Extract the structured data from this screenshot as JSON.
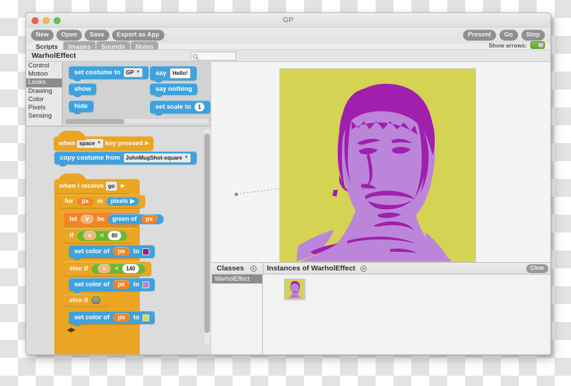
{
  "window": {
    "title": "GP",
    "traffic_lights": [
      "close-red",
      "minimize-yellow",
      "maximize-green"
    ]
  },
  "toolbar": {
    "buttons": [
      "New",
      "Open",
      "Save",
      "Export as App"
    ],
    "right_buttons": [
      "Present",
      "Go",
      "Stop"
    ],
    "show_arrows_label": "Show arrows:",
    "show_arrows_on": true,
    "toggle_color": "#5fa930"
  },
  "tabs": [
    {
      "label": "Scripts",
      "active": true
    },
    {
      "label": "Images",
      "active": false
    },
    {
      "label": "Sounds",
      "active": false
    },
    {
      "label": "Notes",
      "active": false
    }
  ],
  "class_header": {
    "name": "WarholEffect",
    "search_placeholder": ""
  },
  "palette": {
    "categories": [
      "Control",
      "Motion",
      "Looks",
      "Drawing",
      "Color",
      "Pixels",
      "Sensing"
    ],
    "selected_category": "Looks",
    "blocks": [
      {
        "text_before": "set costume to",
        "dropdown": "GP",
        "text_after": ""
      },
      {
        "text_before": "say",
        "input": "Hello!"
      },
      {
        "text_before": "show"
      },
      {
        "text_before": "say nothing"
      },
      {
        "text_before": "hide"
      },
      {
        "text_before": "set scale to",
        "number": "1"
      }
    ]
  },
  "scripts": {
    "stack_one": {
      "hat": {
        "pre": "when",
        "dropdown": "space",
        "post": "key pressed"
      },
      "body": [
        {
          "pre": "copy costume from",
          "dropdown": "JohnMugShot-square"
        }
      ]
    },
    "stack_two": {
      "hat": {
        "pre": "when I receive",
        "message": "go"
      },
      "for_loop": {
        "pre": "for",
        "var": "px",
        "mid": "in",
        "list": "pixels"
      },
      "let": {
        "pre": "let",
        "var": "v",
        "mid": "be",
        "reporter": "green of",
        "arg": "px"
      },
      "branches": [
        {
          "kind": "if",
          "label": "if",
          "var": "v",
          "op": "<",
          "value": "80",
          "action": {
            "pre": "set color of",
            "var": "px",
            "mid": "to",
            "color": "#8e1bb0"
          }
        },
        {
          "kind": "elseif",
          "label": "else if",
          "var": "v",
          "op": "<",
          "value": "140",
          "action": {
            "pre": "set color of",
            "var": "px",
            "mid": "to",
            "color": "#c07fe0"
          }
        },
        {
          "kind": "elseif-empty",
          "label": "else if",
          "var": "",
          "op": "",
          "value": "",
          "action": {
            "pre": "set color of",
            "var": "px",
            "mid": "to",
            "color": "#d8d85e"
          }
        }
      ]
    }
  },
  "stage": {
    "portrait_colors": {
      "background": "#d5d353",
      "mid": "#bb86da",
      "dark": "#a01fae"
    },
    "handle_label": "stage-anchor-handle"
  },
  "panels": {
    "classes": {
      "title": "Classes",
      "add_icon": "plus-circle-icon",
      "items": [
        "WarholEffect"
      ],
      "selected": "WarholEffect"
    },
    "instances": {
      "title": "Instances of WarholEffect",
      "add_icon": "plus-circle-icon",
      "clear_label": "Clear",
      "items": [
        "WarholEffect-instance-thumbnail"
      ]
    }
  }
}
